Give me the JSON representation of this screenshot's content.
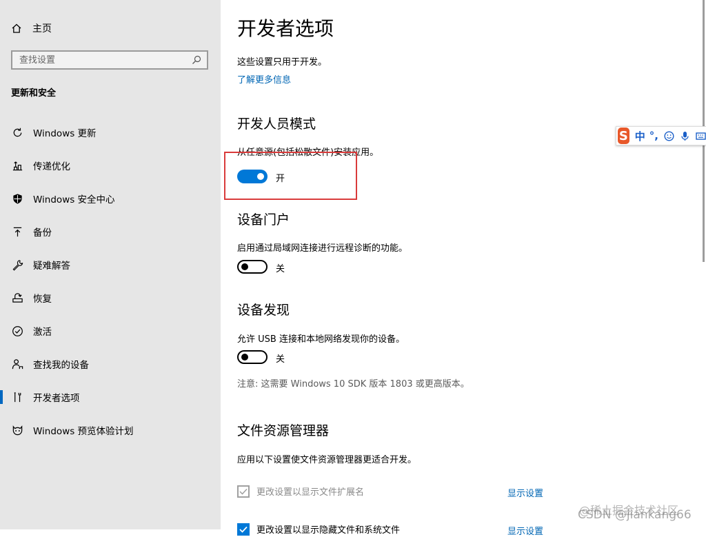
{
  "sidebar": {
    "home_label": "主页",
    "search_placeholder": "查找设置",
    "section_title": "更新和安全",
    "items": [
      {
        "label": "Windows 更新",
        "icon": "refresh-icon",
        "active": false
      },
      {
        "label": "传递优化",
        "icon": "delivery-optimization-icon",
        "active": false
      },
      {
        "label": "Windows 安全中心",
        "icon": "shield-icon",
        "active": false
      },
      {
        "label": "备份",
        "icon": "backup-arrow-icon",
        "active": false
      },
      {
        "label": "疑难解答",
        "icon": "wrench-icon",
        "active": false
      },
      {
        "label": "恢复",
        "icon": "recovery-icon",
        "active": false
      },
      {
        "label": "激活",
        "icon": "check-circle-icon",
        "active": false
      },
      {
        "label": "查找我的设备",
        "icon": "person-location-icon",
        "active": false
      },
      {
        "label": "开发者选项",
        "icon": "developer-tools-icon",
        "active": true
      },
      {
        "label": "Windows 预览体验计划",
        "icon": "insider-cat-icon",
        "active": false
      }
    ]
  },
  "main": {
    "title": "开发者选项",
    "intro": "这些设置只用于开发。",
    "learn_more": "了解更多信息",
    "dev_mode": {
      "heading": "开发人员模式",
      "description": "从任意源(包括松散文件)安装应用。",
      "state": "on",
      "state_label": "开"
    },
    "device_portal": {
      "heading": "设备门户",
      "description": "启用通过局域网连接进行远程诊断的功能。",
      "state": "off",
      "state_label": "关"
    },
    "device_discovery": {
      "heading": "设备发现",
      "description": "允许 USB 连接和本地网络发现你的设备。",
      "state": "off",
      "state_label": "关",
      "note": "注意: 这需要 Windows 10 SDK 版本 1803 或更高版本。"
    },
    "file_explorer": {
      "heading": "文件资源管理器",
      "description": "应用以下设置使文件资源管理器更适合开发。",
      "options": [
        {
          "label": "更改设置以显示文件扩展名",
          "checked": false,
          "disabled": true,
          "link": "显示设置"
        },
        {
          "label": "更改设置以显示隐藏文件和系统文件",
          "checked": true,
          "disabled": false,
          "link": "显示设置"
        }
      ]
    }
  },
  "ime_toolbar": {
    "logo": "S",
    "mode": "中",
    "punctuation": "°,",
    "icons": [
      "emoji-icon",
      "microphone-icon",
      "keyboard-icon"
    ]
  },
  "watermark": {
    "line1": "@稀土掘金技术社区",
    "line2": "CSDN @jiankang66"
  },
  "colors": {
    "accent": "#0078d7",
    "link": "#0066b4",
    "sidebar_bg": "#e6e6e6",
    "highlight_box": "#d93a3a"
  }
}
